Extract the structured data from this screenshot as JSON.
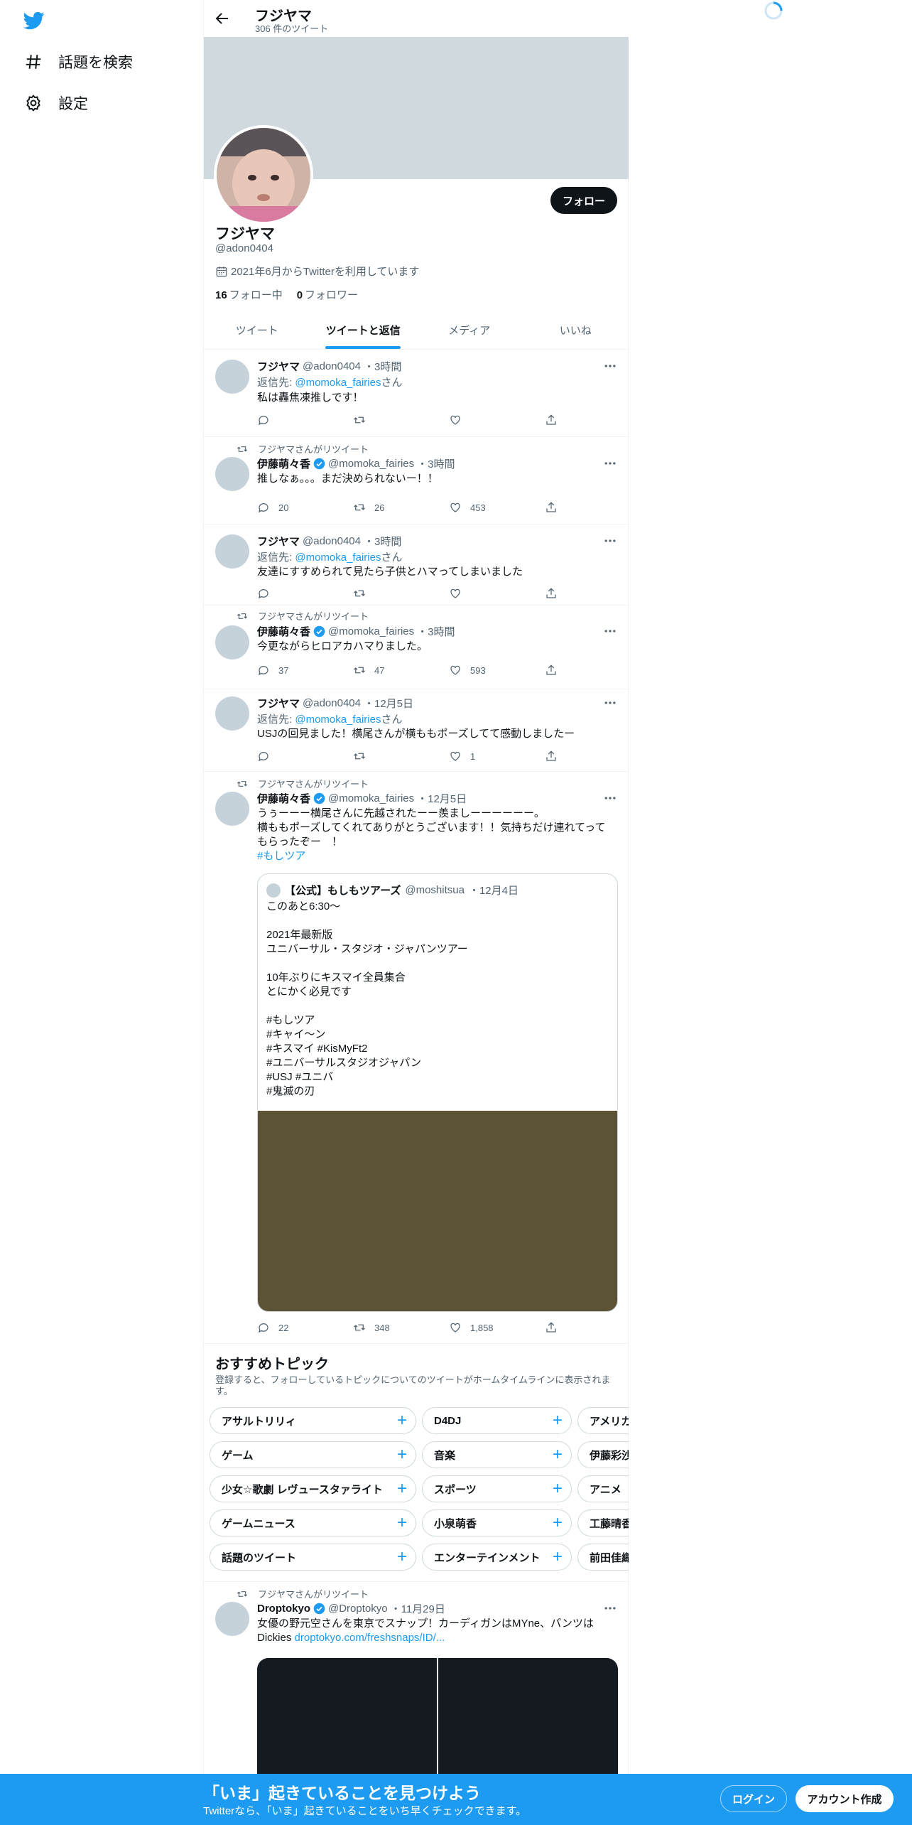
{
  "nav": {
    "explore_label": "話題を検索",
    "settings_label": "設定"
  },
  "profile": {
    "topbar_name": "フジヤマ",
    "tweet_count": "306 件のツイート",
    "name": "フジヤマ",
    "handle": "@adon0404",
    "joined": "2021年6月からTwitterを利用しています",
    "following_count": "16",
    "following_label": "フォロー中",
    "followers_count": "0",
    "followers_label": "フォロワー",
    "follow_button": "フォロー"
  },
  "tabs": [
    "ツイート",
    "ツイートと返信",
    "メディア",
    "いいね"
  ],
  "tweets": [
    {
      "name": "フジヤマ",
      "handle": "@adon0404",
      "time": "・3時間",
      "reply_prefix": "返信先: ",
      "reply_to": "@momoka_fairies",
      "reply_suffix": "さん",
      "text": "私は轟焦凍推しです！",
      "replies": "",
      "retweets": "",
      "likes": ""
    },
    {
      "retweeted_by": "フジヤマさんがリツイート",
      "name": "伊藤萌々香",
      "handle": "@momoka_fairies",
      "time": "・3時間",
      "text": "推しなぁ。。。まだ決められないー！！",
      "replies": "20",
      "retweets": "26",
      "likes": "453"
    },
    {
      "name": "フジヤマ",
      "handle": "@adon0404",
      "time": "・3時間",
      "reply_prefix": "返信先: ",
      "reply_to": "@momoka_fairies",
      "reply_suffix": "さん",
      "text": "友達にすすめられて見たら子供とハマってしまいました",
      "replies": "",
      "retweets": "",
      "likes": ""
    },
    {
      "retweeted_by": "フジヤマさんがリツイート",
      "name": "伊藤萌々香",
      "handle": "@momoka_fairies",
      "time": "・3時間",
      "text": "今更ながらヒロアカハマりました。",
      "replies": "37",
      "retweets": "47",
      "likes": "593"
    },
    {
      "name": "フジヤマ",
      "handle": "@adon0404",
      "time": "・12月5日",
      "reply_prefix": "返信先: ",
      "reply_to": "@momoka_fairies",
      "reply_suffix": "さん",
      "text": "USJの回見ました！横尾さんが横ももポーズしてて感動しましたー",
      "replies": "",
      "retweets": "",
      "likes": "1"
    },
    {
      "retweeted_by": "フジヤマさんがリツイート",
      "name": "伊藤萌々香",
      "handle": "@momoka_fairies",
      "time": "・12月5日",
      "text_line1": "うぅーーー横尾さんに先越されたーー羨ましーーーーーー。",
      "text_line2": "横ももポーズしてくれてありがとうございます！！気持ちだけ連れてって",
      "text_line3": "もらったぞー　！",
      "hashtag": "#もしツア",
      "replies": "22",
      "retweets": "348",
      "likes": "1,858",
      "quote": {
        "name": "【公式】もしもツアーズ",
        "handle": "@moshitsua",
        "time": "・12月4日",
        "lines": [
          "このあと6:30〜",
          "",
          "2021年最新版",
          "ユニバーサル・スタジオ・ジャパンツアー",
          "",
          "10年ぶりにキスマイ全員集合",
          "とにかく必見です",
          "",
          "#もしツア",
          "#キャイ〜ン",
          "#キスマイ #KisMyFt2",
          "#ユニバーサルスタジオジャパン",
          "#USJ #ユニバ",
          "#鬼滅の刃"
        ]
      }
    },
    {
      "retweeted_by": "フジヤマさんがリツイート",
      "name": "Droptokyo",
      "handle": "@Droptokyo",
      "time": "・11月29日",
      "text_line1": "女優の野元空さんを東京でスナップ！カーディガンはMYne、パンツは",
      "text_line2_prefix": "Dickies ",
      "link": "droptokyo.com/freshsnaps/ID/..."
    }
  ],
  "topics": {
    "title": "おすすめトピック",
    "subtitle": "登録すると、フォローしているトピックについてのツイートがホームタイムラインに表示されます。",
    "rows": [
      [
        "アサルトリリィ",
        "D4DJ",
        "アメリカ"
      ],
      [
        "ゲーム",
        "音楽",
        "伊藤彩沙"
      ],
      [
        "少女☆歌劇 レヴュースタァライト",
        "スポーツ",
        "アニメ"
      ],
      [
        "ゲームニュース",
        "小泉萌香",
        "工藤晴香"
      ],
      [
        "話題のツイート",
        "エンターテインメント",
        "前田佳織"
      ]
    ]
  },
  "bottom_bar": {
    "title": "「いま」起きていることを見つけよう",
    "subtitle": "Twitterなら、「いま」起きていることをいち早くチェックできます。",
    "login": "ログイン",
    "signup": "アカウント作成"
  },
  "colors": {
    "accent": "#1d9bf0",
    "banner": "#cfd9de",
    "dark_button": "#0f1419"
  }
}
